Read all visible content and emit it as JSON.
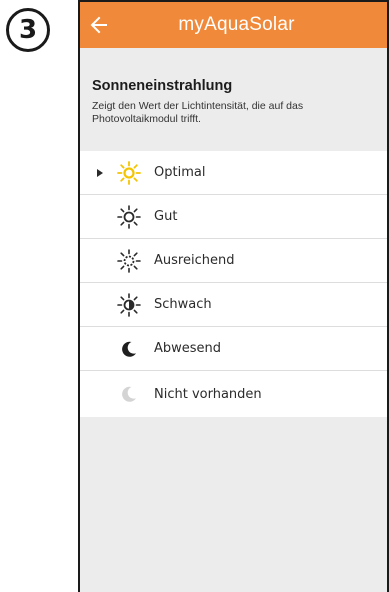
{
  "step_badge": "3",
  "appbar": {
    "title": "myAquaSolar",
    "back_icon": "arrow-left-icon"
  },
  "header": {
    "title": "Sonneneinstrahlung",
    "description": "Zeigt den Wert der Lichtintensität, die auf das Photovoltaikmodul trifft."
  },
  "options": [
    {
      "label": "Optimal",
      "icon": "sun-full-icon",
      "selected": true
    },
    {
      "label": "Gut",
      "icon": "sun-outline-icon",
      "selected": false
    },
    {
      "label": "Ausreichend",
      "icon": "sun-dotted-icon",
      "selected": false
    },
    {
      "label": "Schwach",
      "icon": "sun-half-icon",
      "selected": false
    },
    {
      "label": "Abwesend",
      "icon": "moon-icon",
      "selected": false
    },
    {
      "label": "Nicht vorhanden",
      "icon": "moon-faded-icon",
      "selected": false
    }
  ],
  "colors": {
    "appbar": "#f08a3a",
    "sun_optimal": "#f5c400"
  }
}
